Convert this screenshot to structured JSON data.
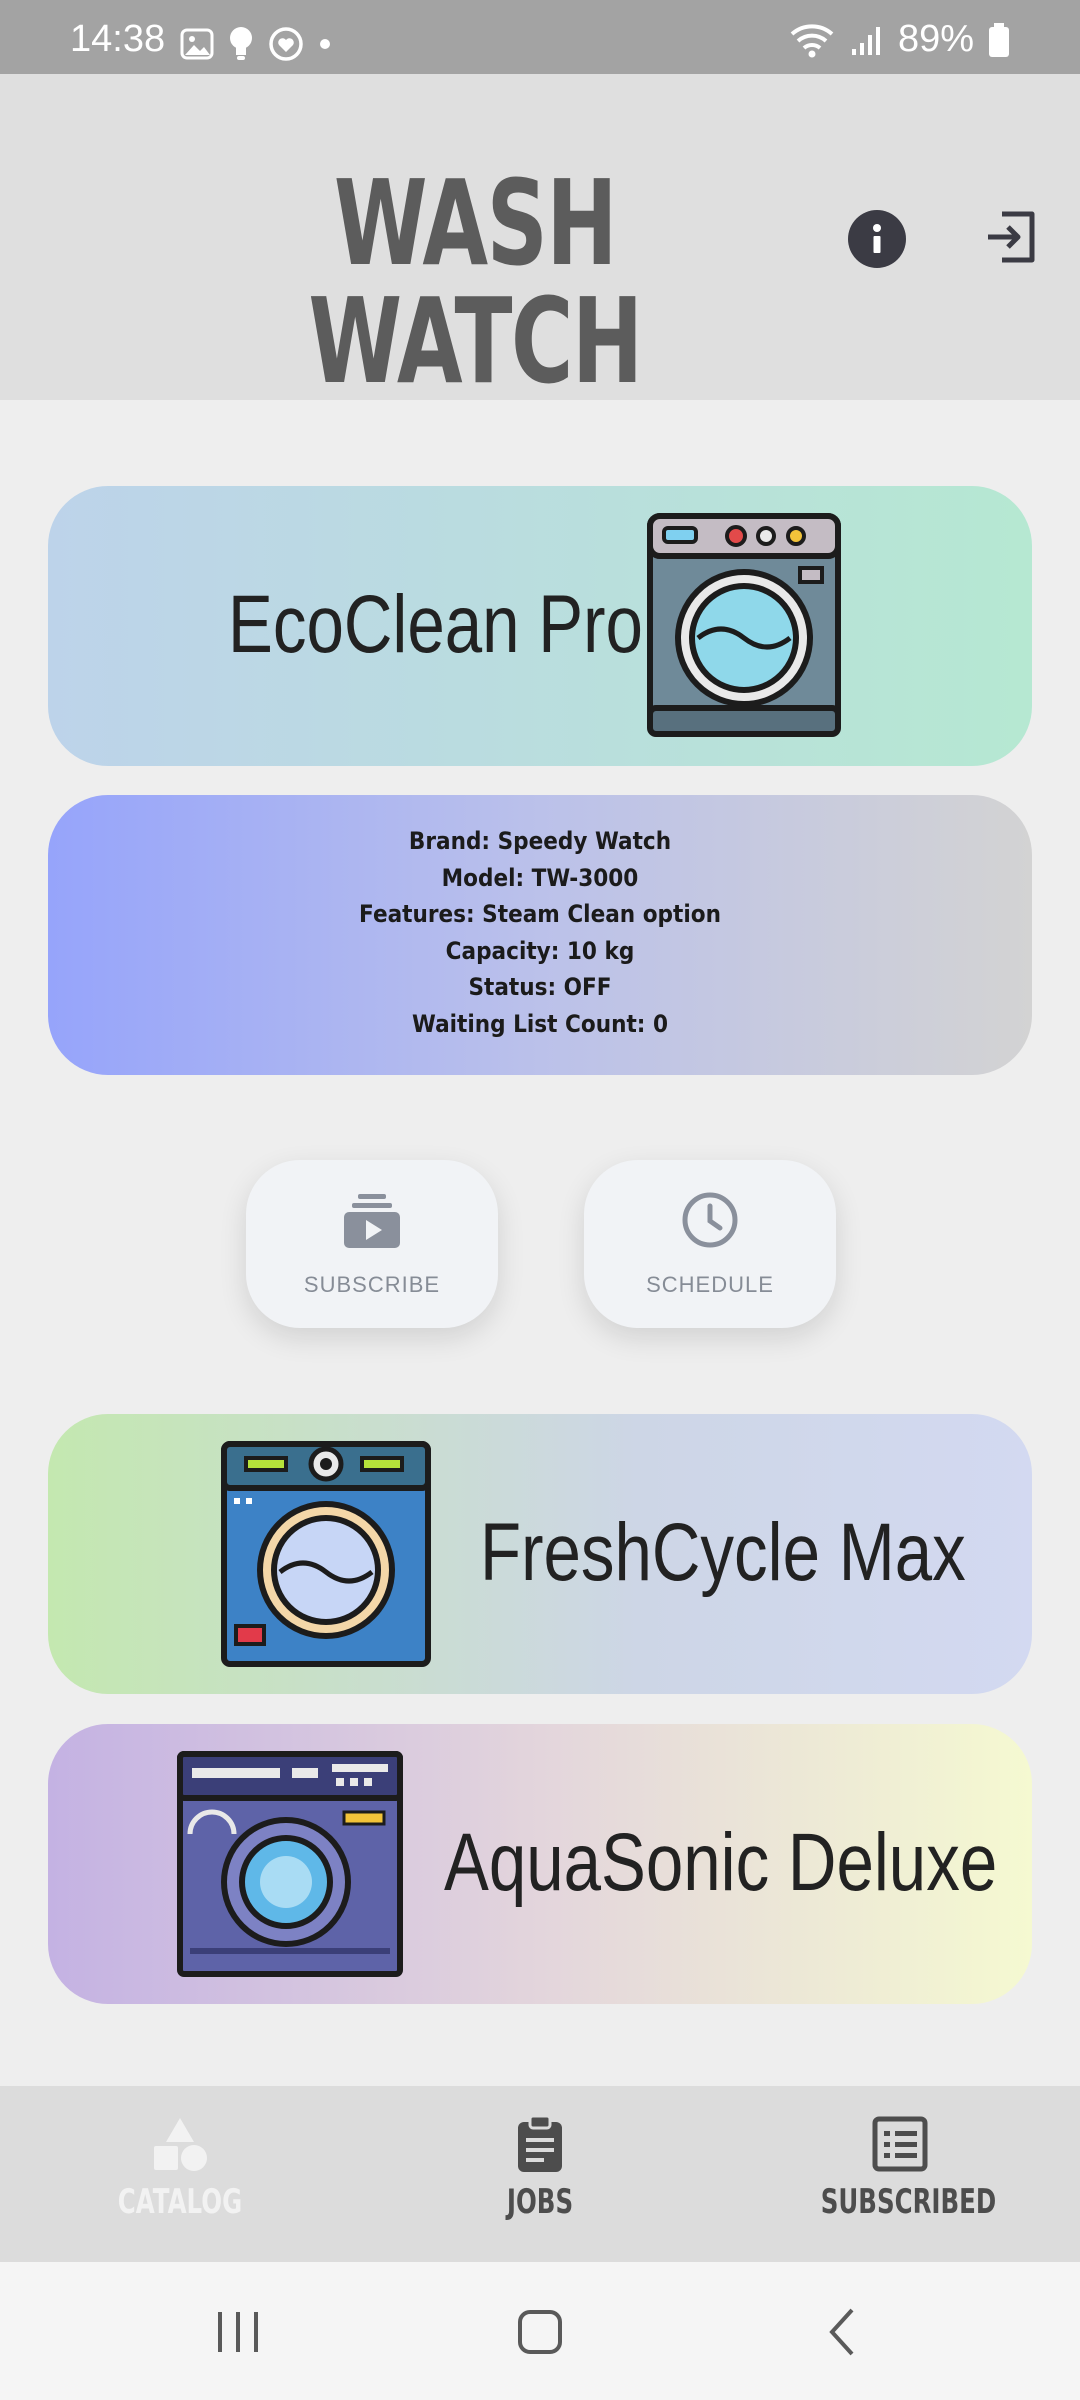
{
  "status_bar": {
    "time": "14:38",
    "battery": "89%"
  },
  "header": {
    "title": "WASH WATCH"
  },
  "machines": [
    {
      "name": "EcoClean Pro",
      "icon": "washing-machine-icon"
    },
    {
      "name": "FreshCycle Max",
      "icon": "washing-machine-icon"
    },
    {
      "name": "AquaSonic Deluxe",
      "icon": "washing-machine-icon"
    }
  ],
  "details": {
    "brand": "Brand: Speedy Watch",
    "model": "Model: TW-3000",
    "features": "Features: Steam Clean option",
    "capacity": "Capacity: 10 kg",
    "status": "Status: OFF",
    "waiting": "Waiting List Count: 0"
  },
  "actions": {
    "subscribe": "SUBSCRIBE",
    "schedule": "SCHEDULE"
  },
  "bottom_nav": {
    "catalog": "CATALOG",
    "jobs": "JOBS",
    "subscribed": "SUBSCRIBED"
  },
  "colors": {
    "header_bg": "#dfdfdf",
    "title": "#5c5c5c",
    "nav_bg": "#dcdcdc",
    "nav_active": "#f2f2f2"
  }
}
